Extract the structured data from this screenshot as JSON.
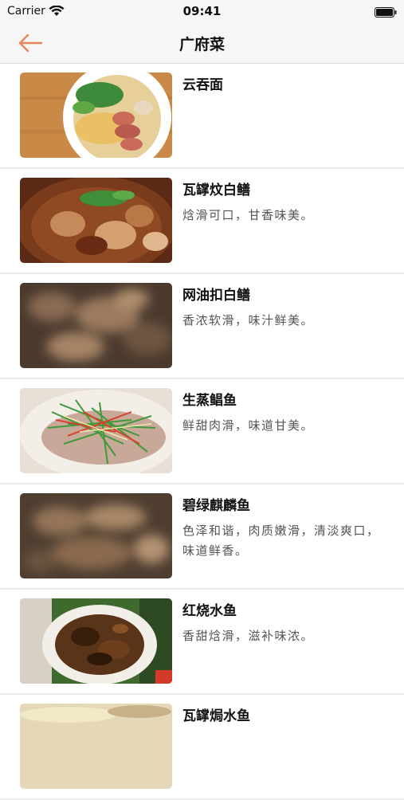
{
  "status_bar": {
    "carrier": "Carrier",
    "time": "09:41"
  },
  "nav": {
    "title": "广府菜",
    "back_icon": "back-arrow-icon",
    "accent_color": "#e8845a"
  },
  "dishes": [
    {
      "name": "云吞面",
      "description": ""
    },
    {
      "name": "瓦罉炆白鳝",
      "description": "焓滑可口，甘香味美。"
    },
    {
      "name": "网油扣白鳝",
      "description": "香浓软滑，味汁鲜美。"
    },
    {
      "name": "生蒸鲳鱼",
      "description": "鲜甜肉滑，味道甘美。"
    },
    {
      "name": "碧绿麒麟鱼",
      "description": "色泽和谐，肉质嫩滑，清淡爽口，味道鲜香。"
    },
    {
      "name": "红烧水鱼",
      "description": "香甜焓滑，滋补味浓。"
    },
    {
      "name": "瓦罉焗水鱼",
      "description": ""
    }
  ]
}
